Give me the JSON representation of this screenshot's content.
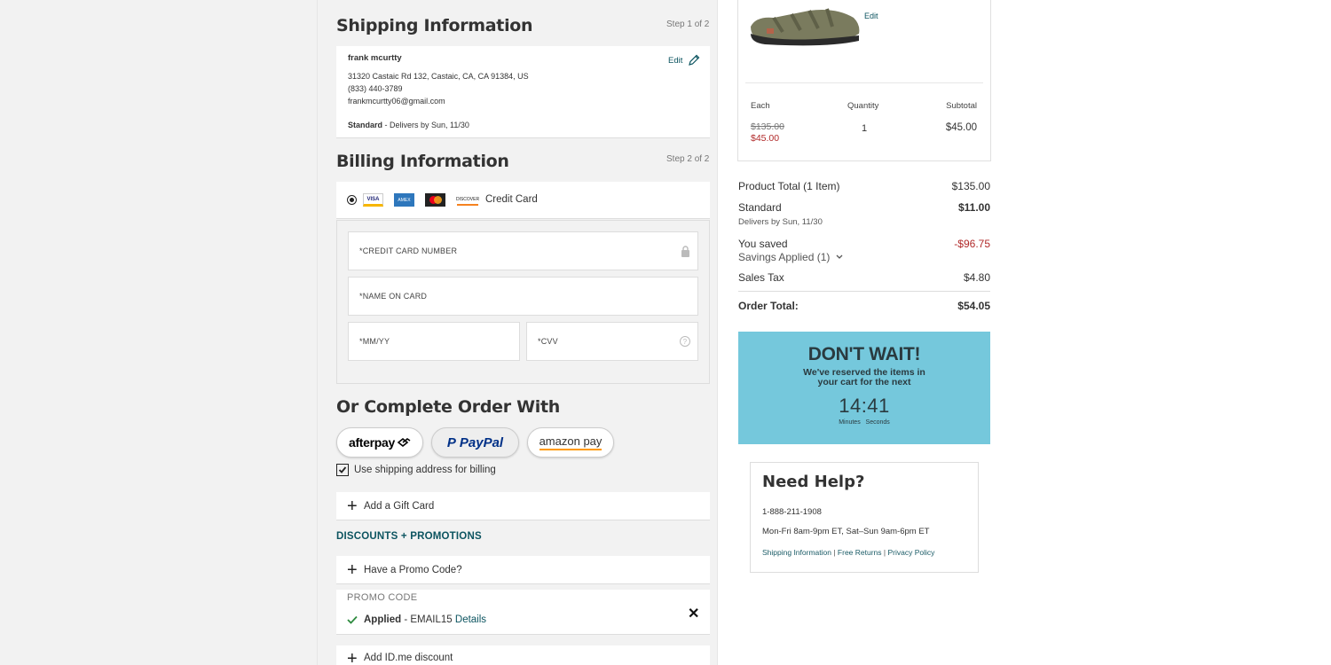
{
  "shipping": {
    "title": "Shipping Information",
    "step": "Step 1 of 2",
    "name": "frank mcurtty",
    "address": "31320 Castaic Rd 132, Castaic, CA, CA 91384, US",
    "phone": "(833) 440-3789",
    "email": "frankmcurtty06@gmail.com",
    "method_label": "Standard",
    "method_detail": " - Delivers by Sun, 11/30",
    "edit_label": "Edit"
  },
  "billing": {
    "title": "Billing Information",
    "step": "Step 2 of 2",
    "credit_card_label": "Credit Card",
    "card_logos": [
      "VISA",
      "AMEX",
      "MC",
      "DISCOVER"
    ],
    "card_number_placeholder": "*CREDIT CARD NUMBER",
    "name_on_card_placeholder": "*NAME ON CARD",
    "expiry_placeholder": "*MM/YY",
    "cvv_placeholder": "*CVV"
  },
  "alt_pay": {
    "title": "Or Complete Order With",
    "afterpay_label": "afterpay",
    "paypal_label": "PayPal",
    "amazon_label": "amazon pay"
  },
  "use_shipping_label": "Use shipping address for billing",
  "gift_card_label": "Add a Gift Card",
  "discounts_title": "DISCOUNTS + PROMOTIONS",
  "promo_question": "Have a Promo Code?",
  "promo": {
    "label": "PROMO CODE",
    "applied": "Applied",
    "code": " - EMAIL15 ",
    "details": "Details"
  },
  "idme_label": "Add ID.me discount",
  "cart_item": {
    "edit_label": "Edit",
    "each_header": "Each",
    "quantity_header": "Quantity",
    "subtotal_header": "Subtotal",
    "original_price": "$135.00",
    "sale_price": "$45.00",
    "quantity": "1",
    "subtotal": "$45.00"
  },
  "summary": {
    "product_total_label": "Product Total (1 Item)",
    "product_total_value": "$135.00",
    "shipping_label": "Standard",
    "shipping_value": "$11.00",
    "shipping_detail": "Delivers by Sun, 11/30",
    "saved_label": "You saved",
    "saved_value": "-$96.75",
    "savings_applied": "Savings Applied (1)",
    "tax_label": "Sales Tax",
    "tax_value": "$4.80",
    "order_total_label": "Order Total:",
    "order_total_value": "$54.05"
  },
  "timer": {
    "title": "DON'T WAIT!",
    "line1": "We've reserved the items in",
    "line2": "your cart for the next",
    "time": "14:41",
    "minutes_label": "Minutes",
    "seconds_label": "Seconds",
    "bg_color": "#75c8dc"
  },
  "help": {
    "title": "Need Help?",
    "phone": "1-888-211-1908",
    "hours": "Mon-Fri 8am-9pm ET, Sat–Sun 9am-6pm ET",
    "link1": "Shipping Information",
    "link2": "Free Returns",
    "link3": "Privacy Policy"
  },
  "colors": {
    "accent": "#0c5460",
    "sale_red": "#b12a2a",
    "background": "#f2f2f2"
  }
}
